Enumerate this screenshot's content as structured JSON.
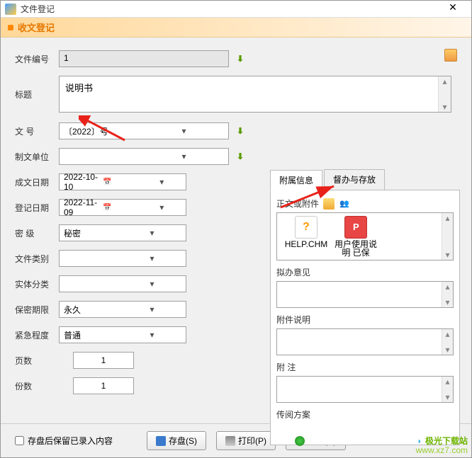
{
  "window": {
    "title": "文件登记"
  },
  "header": {
    "title": "收文登记"
  },
  "fields": {
    "file_no": {
      "label": "文件编号",
      "value": "1"
    },
    "title": {
      "label": "标题",
      "value": "说明书"
    },
    "doc_no": {
      "label": "文 号",
      "value": "〔2022〕号"
    },
    "org": {
      "label": "制文单位",
      "value": ""
    },
    "create_date": {
      "label": "成文日期",
      "value": "2022-10-10"
    },
    "reg_date": {
      "label": "登记日期",
      "value": "2022-11-09"
    },
    "secrecy": {
      "label": "密 级",
      "value": "秘密"
    },
    "doc_type": {
      "label": "文件类别",
      "value": ""
    },
    "entity": {
      "label": "实体分类",
      "value": ""
    },
    "retention": {
      "label": "保密期限",
      "value": "永久"
    },
    "urgency": {
      "label": "紧急程度",
      "value": "普通"
    },
    "pages": {
      "label": "页数",
      "value": "1"
    },
    "copies": {
      "label": "份数",
      "value": "1"
    }
  },
  "tabs": {
    "t1": "附属信息",
    "t2": "督办与存放"
  },
  "panel": {
    "attachments": {
      "label": "正文或附件",
      "items": [
        "HELP.CHM",
        "用户使用说明 已保"
      ]
    },
    "opinion": {
      "label": "拟办意见"
    },
    "attach_desc": {
      "label": "附件说明"
    },
    "remark": {
      "label": "附 注"
    },
    "circ": {
      "label": "传阅方案"
    }
  },
  "footer": {
    "checkbox": "存盘后保留已录入内容",
    "save": "存盘(S)",
    "print": "打印(P)",
    "close": "关闭(C)"
  },
  "watermark": {
    "name": "极光下载站",
    "url": "www.xz7.com"
  }
}
